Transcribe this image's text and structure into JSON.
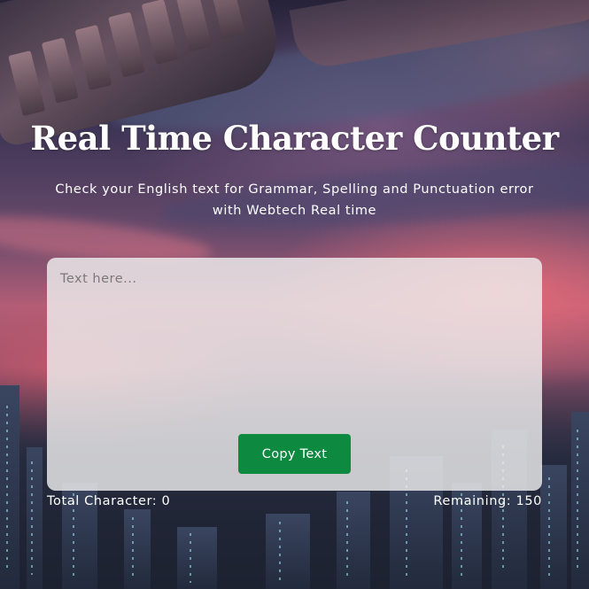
{
  "header": {
    "title": "Real Time Character Counter",
    "subtitle": "Check your English text for Grammar, Spelling and Punctuation error with Webtech Real time"
  },
  "editor": {
    "value": "",
    "placeholder": "Text here...",
    "copy_button_label": "Copy Text"
  },
  "stats": {
    "total_label": "Total Character:",
    "total_value": "0",
    "remaining_label": "Remaining:",
    "remaining_value": "150"
  },
  "colors": {
    "button_bg": "#0e8940",
    "panel_bg": "#eeeeee",
    "text": "#ffffff"
  }
}
